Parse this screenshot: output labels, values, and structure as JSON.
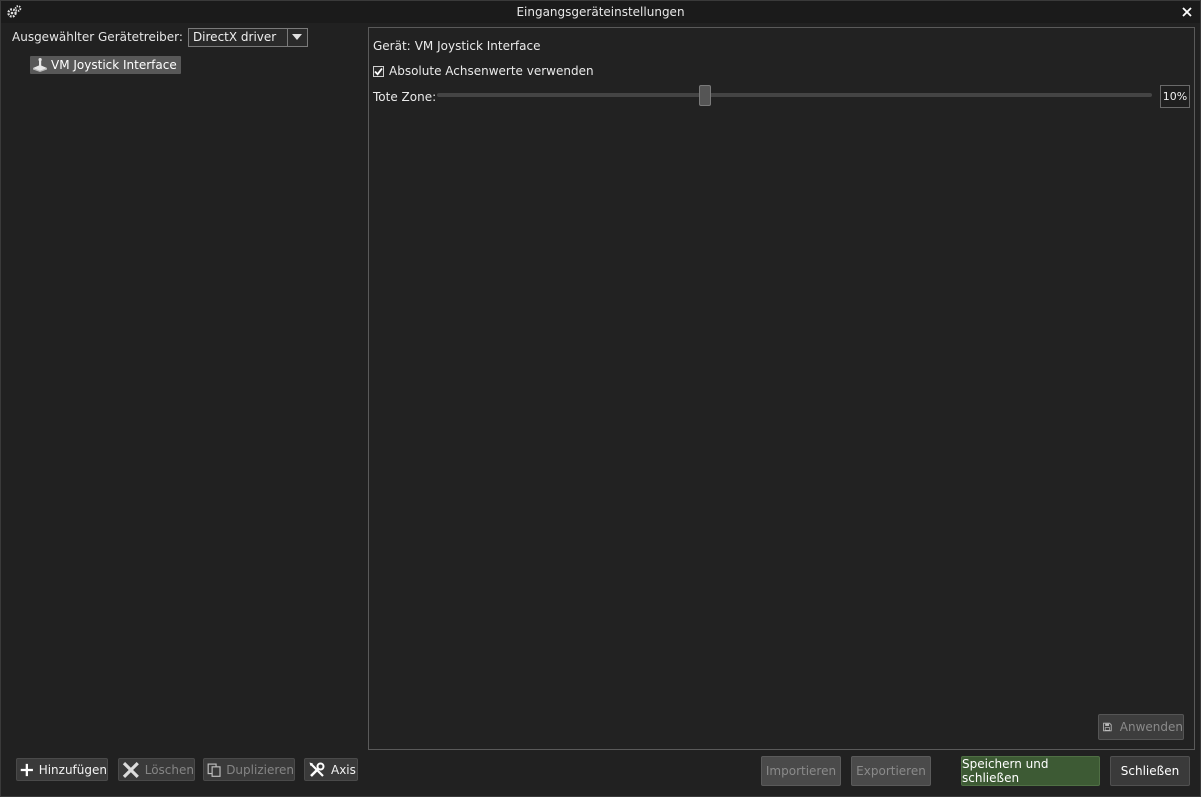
{
  "window": {
    "title": "Eingangsgeräteinstellungen",
    "icons": {
      "app": "gears-icon",
      "close": "close-icon"
    }
  },
  "left": {
    "driver_label": "Ausgewählter Gerätetreiber:",
    "driver_value": "DirectX driver",
    "devices": [
      {
        "label": "VM Joystick Interface",
        "icon": "joystick-icon",
        "selected": true
      }
    ]
  },
  "right": {
    "device_label": "Gerät:",
    "device_name": "VM Joystick Interface",
    "absolute_axes_label": "Absolute Achsenwerte verwenden",
    "absolute_axes_checked": true,
    "dead_zone_label": "Tote Zone:",
    "dead_zone_value": "10%",
    "dead_zone_fraction": 0.375,
    "apply_label": "Anwenden",
    "apply_enabled": false
  },
  "bottom": {
    "add_label": "Hinzufügen",
    "delete_label": "Löschen",
    "duplicate_label": "Duplizieren",
    "axis_label": "Axis",
    "import_label": "Importieren",
    "export_label": "Exportieren",
    "save_close_label": "Speichern und schließen",
    "close_label": "Schließen"
  },
  "colors": {
    "background": "#212121",
    "save_button": "#3d5a34",
    "selected_item": "#585858"
  }
}
